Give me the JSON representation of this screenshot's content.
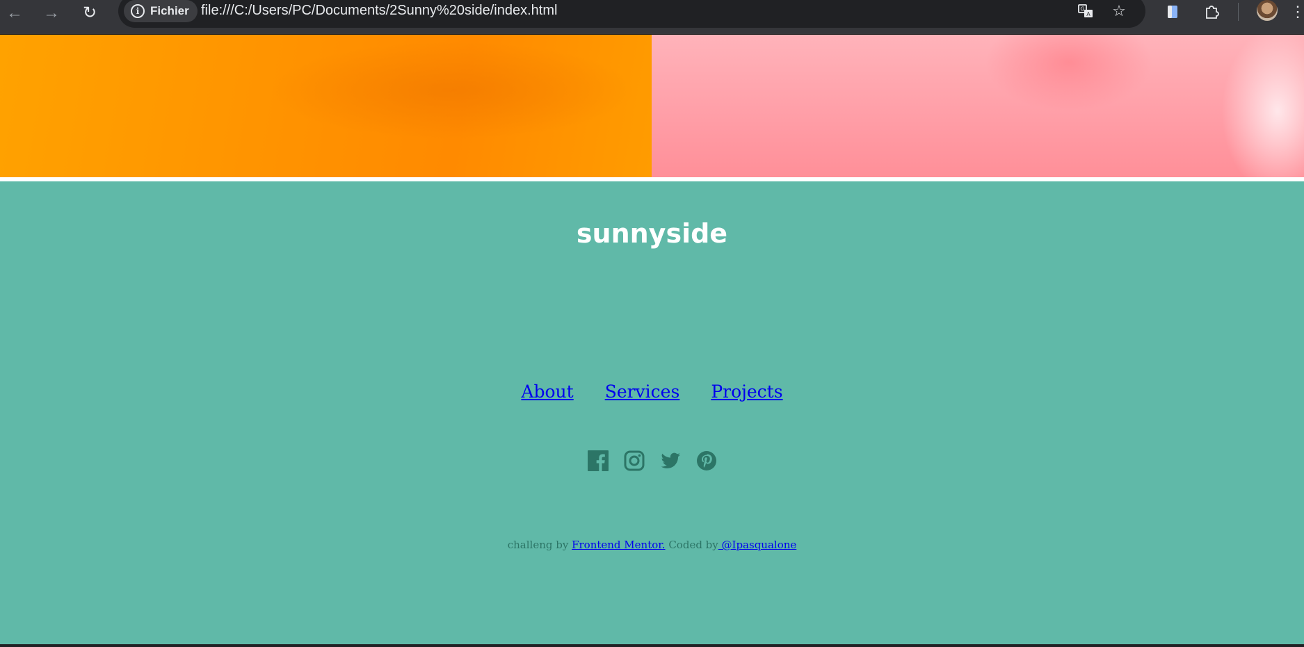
{
  "browser": {
    "site_chip_label": "Fichier",
    "url": "file:///C:/Users/PC/Documents/2Sunny%20side/index.html",
    "icons": [
      "back-icon",
      "forward-icon",
      "reload-icon",
      "translate-icon",
      "star-icon",
      "side-panel-icon",
      "extensions-icon",
      "menu-icon"
    ]
  },
  "footer": {
    "logo": "sunnyside",
    "nav": [
      "About",
      "Services",
      "Projects"
    ],
    "social_icons": [
      "facebook-icon",
      "instagram-icon",
      "twitter-icon",
      "pinterest-icon"
    ],
    "attribution": {
      "prefix": "challeng by",
      "mentor_link": "Frontend Mentor.",
      "coded_by": "Coded by",
      "author_link": " @Ipasqualone"
    },
    "background_color": "#60b9a8",
    "icon_color": "#2c7566"
  },
  "gallery": {
    "left_color": "#ffa200",
    "right_color": "#ffa3ab"
  }
}
